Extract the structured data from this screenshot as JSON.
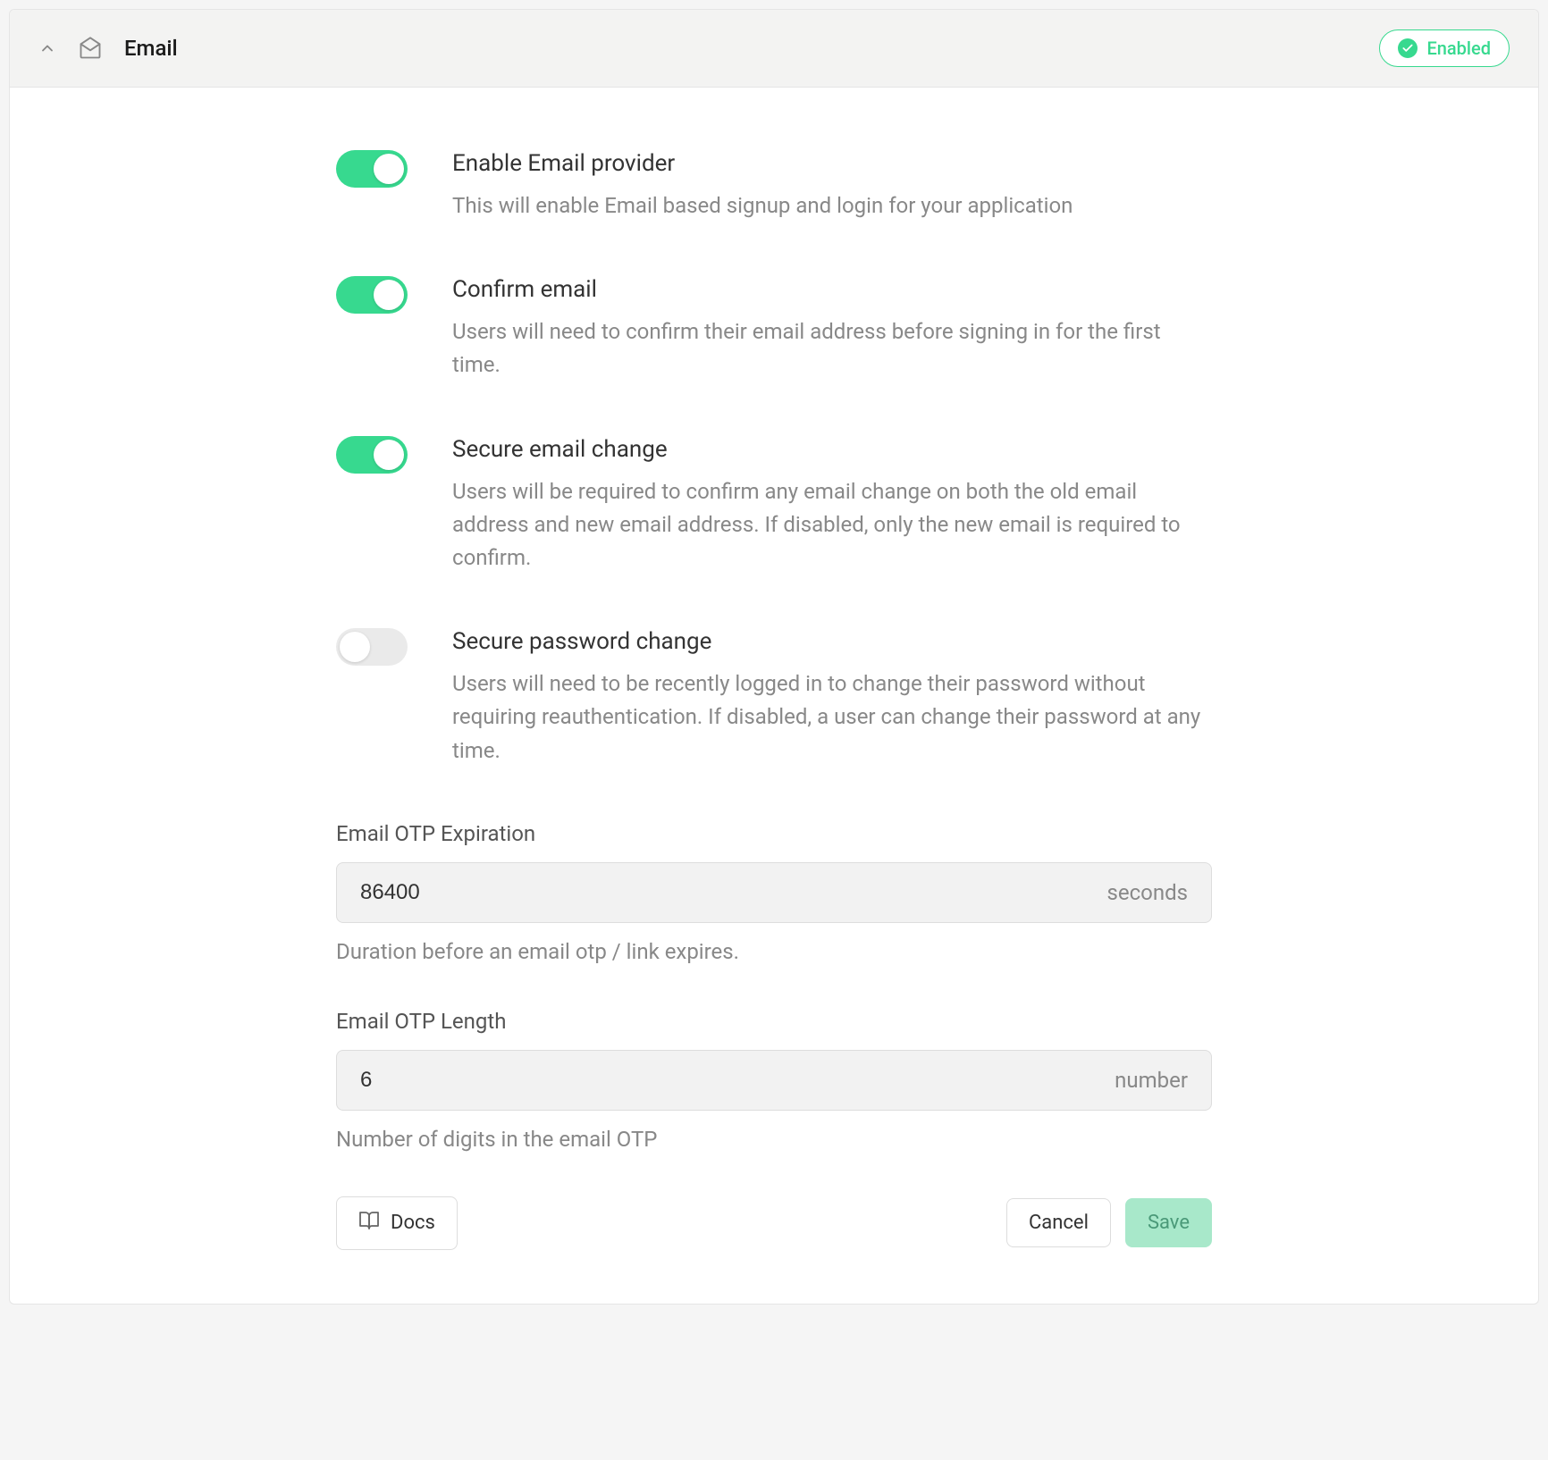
{
  "header": {
    "title": "Email",
    "status_label": "Enabled"
  },
  "settings": [
    {
      "enabled": true,
      "title": "Enable Email provider",
      "description": "This will enable Email based signup and login for your application"
    },
    {
      "enabled": true,
      "title": "Confirm email",
      "description": "Users will need to confirm their email address before signing in for the first time."
    },
    {
      "enabled": true,
      "title": "Secure email change",
      "description": "Users will be required to confirm any email change on both the old email address and new email address. If disabled, only the new email is required to confirm."
    },
    {
      "enabled": false,
      "title": "Secure password change",
      "description": "Users will need to be recently logged in to change their password without requiring reauthentication. If disabled, a user can change their password at any time."
    }
  ],
  "fields": {
    "otp_expiration": {
      "label": "Email OTP Expiration",
      "value": "86400",
      "suffix": "seconds",
      "helper": "Duration before an email otp / link expires."
    },
    "otp_length": {
      "label": "Email OTP Length",
      "value": "6",
      "suffix": "number",
      "helper": "Number of digits in the email OTP"
    }
  },
  "footer": {
    "docs_label": "Docs",
    "cancel_label": "Cancel",
    "save_label": "Save"
  }
}
